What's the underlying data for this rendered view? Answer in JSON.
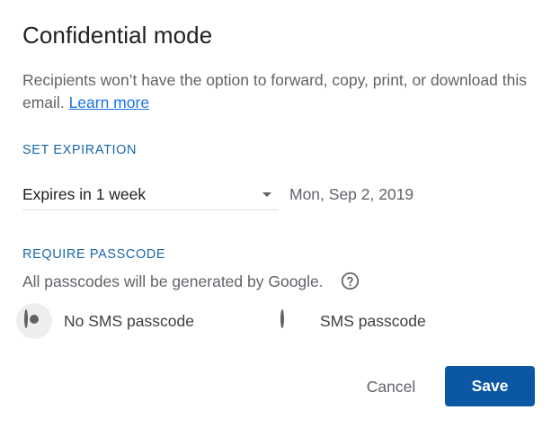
{
  "dialog": {
    "title": "Confidential mode",
    "description": "Recipients won’t have the option to forward, copy, print, or download this email.",
    "learn_more": "Learn more"
  },
  "expiration": {
    "label": "SET EXPIRATION",
    "selected": "Expires in 1 week",
    "date": "Mon, Sep 2, 2019"
  },
  "passcode": {
    "label": "REQUIRE PASSCODE",
    "info": "All passcodes will be generated by Google.",
    "help_icon": "question-circle-icon",
    "options": [
      {
        "label": "No SMS passcode",
        "checked": true
      },
      {
        "label": "SMS passcode",
        "checked": false
      }
    ]
  },
  "actions": {
    "cancel": "Cancel",
    "save": "Save"
  },
  "colors": {
    "accent": "#0b57a4",
    "section_label": "#1967a8",
    "link": "#1a73e8",
    "muted_text": "#5f6368"
  }
}
